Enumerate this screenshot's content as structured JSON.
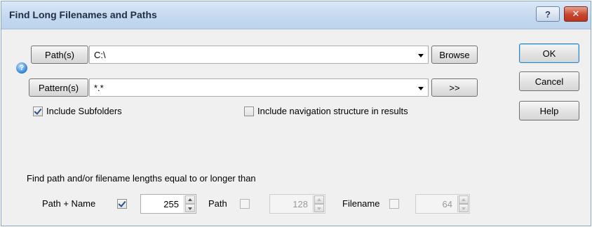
{
  "window": {
    "title": "Find Long Filenames and Paths",
    "help_glyph": "?",
    "close_glyph": "✕"
  },
  "paths": {
    "button_label": "Path(s)",
    "value": "C:\\",
    "browse_label": "Browse"
  },
  "patterns": {
    "help_glyph": "?",
    "button_label": "Pattern(s)",
    "value": "*.*",
    "more_label": ">>"
  },
  "options": {
    "include_subfolders": {
      "label": "Include Subfolders",
      "checked": true
    },
    "include_navigation": {
      "label": "Include navigation structure in results",
      "checked": false
    }
  },
  "actions": {
    "ok_label": "OK",
    "cancel_label": "Cancel",
    "help_label": "Help"
  },
  "lengths": {
    "heading": "Find path and/or filename lengths equal to or longer than",
    "path_name": {
      "label": "Path + Name",
      "checked": true,
      "value": "255"
    },
    "path": {
      "label": "Path",
      "checked": false,
      "value": "128"
    },
    "filename": {
      "label": "Filename",
      "checked": false,
      "value": "64"
    }
  }
}
